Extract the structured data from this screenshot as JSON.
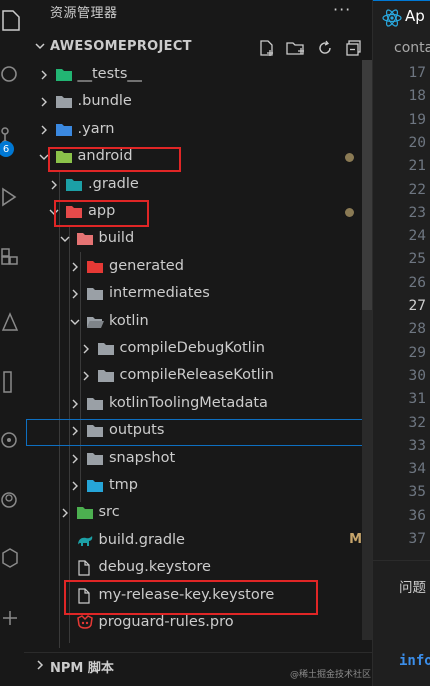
{
  "explorer": {
    "header": "资源管理器",
    "more": "···",
    "project_title": "AWESOMEPROJECT",
    "actions": [
      "new-file-icon",
      "new-folder-icon",
      "refresh-icon",
      "collapse-all-icon"
    ]
  },
  "tree": [
    {
      "label": "__tests__",
      "depth": 1,
      "chevron": "right",
      "icon": "tests-folder-icon",
      "icon_color": "#22b573"
    },
    {
      "label": ".bundle",
      "depth": 1,
      "chevron": "right",
      "icon": "folder-icon",
      "icon_color": "#9aa0a6"
    },
    {
      "label": ".yarn",
      "depth": 1,
      "chevron": "right",
      "icon": "yarn-folder-icon",
      "icon_color": "#3b89e0"
    },
    {
      "label": "android",
      "depth": 1,
      "chevron": "down",
      "icon": "android-folder-icon",
      "icon_color": "#8bc34a",
      "status": "modified-dot"
    },
    {
      "label": ".gradle",
      "depth": 2,
      "chevron": "right",
      "icon": "gradle-folder-icon",
      "icon_color": "#1ca0a6"
    },
    {
      "label": "app",
      "depth": 2,
      "chevron": "down",
      "icon": "app-folder-icon",
      "icon_color": "#e64a4a",
      "status": "modified-dot"
    },
    {
      "label": "build",
      "depth": 3,
      "chevron": "down",
      "icon": "build-folder-icon",
      "icon_color": "#e57373"
    },
    {
      "label": "generated",
      "depth": 4,
      "chevron": "right",
      "icon": "generated-folder-icon",
      "icon_color": "#e53935"
    },
    {
      "label": "intermediates",
      "depth": 4,
      "chevron": "right",
      "icon": "folder-icon",
      "icon_color": "#9aa0a6"
    },
    {
      "label": "kotlin",
      "depth": 4,
      "chevron": "down",
      "icon": "folder-open-icon",
      "icon_color": "#9aa0a6"
    },
    {
      "label": "compileDebugKotlin",
      "depth": 5,
      "chevron": "right",
      "icon": "folder-icon",
      "icon_color": "#9aa0a6"
    },
    {
      "label": "compileReleaseKotlin",
      "depth": 5,
      "chevron": "right",
      "icon": "folder-icon",
      "icon_color": "#9aa0a6"
    },
    {
      "label": "kotlinToolingMetadata",
      "depth": 4,
      "chevron": "right",
      "icon": "folder-icon",
      "icon_color": "#9aa0a6"
    },
    {
      "label": "outputs",
      "depth": 4,
      "chevron": "right",
      "icon": "folder-icon",
      "icon_color": "#9aa0a6",
      "focused": true
    },
    {
      "label": "snapshot",
      "depth": 4,
      "chevron": "right",
      "icon": "folder-icon",
      "icon_color": "#9aa0a6"
    },
    {
      "label": "tmp",
      "depth": 4,
      "chevron": "right",
      "icon": "tmp-folder-icon",
      "icon_color": "#26a5d8"
    },
    {
      "label": "src",
      "depth": 3,
      "chevron": "right",
      "icon": "src-folder-icon",
      "icon_color": "#4caf50"
    },
    {
      "label": "build.gradle",
      "depth": 3,
      "chevron": "none",
      "icon": "gradle-file-icon",
      "icon_color": "#1ca0a6",
      "status": "M"
    },
    {
      "label": "debug.keystore",
      "depth": 3,
      "chevron": "none",
      "icon": "file-icon",
      "icon_color": "#cccccc"
    },
    {
      "label": "my-release-key.keystore",
      "depth": 3,
      "chevron": "none",
      "icon": "file-icon",
      "icon_color": "#cccccc"
    },
    {
      "label": "proguard-rules.pro",
      "depth": 3,
      "chevron": "none",
      "icon": "proguard-file-icon",
      "icon_color": "#e53935"
    }
  ],
  "npm_section": {
    "title": "NPM 脚本"
  },
  "highlights": [
    "android",
    "app",
    "my-release-key.keystore"
  ],
  "editor": {
    "tab_label": "Ap",
    "breadcrumb": "conta",
    "line_numbers": [
      "17",
      "18",
      "19",
      "20",
      "21",
      "22",
      "23",
      "24",
      "25",
      "26",
      "27",
      "28",
      "29",
      "30",
      "31",
      "32",
      "33",
      "34",
      "35",
      "36",
      "37"
    ],
    "current_line": "27",
    "panel_tab": "问题",
    "terminal_text": "info"
  },
  "watermark": "@稀土掘金技术社区",
  "colors": {
    "accent": "#0078d4",
    "highlight_box": "#e02626",
    "modified": "#c7a56b"
  }
}
